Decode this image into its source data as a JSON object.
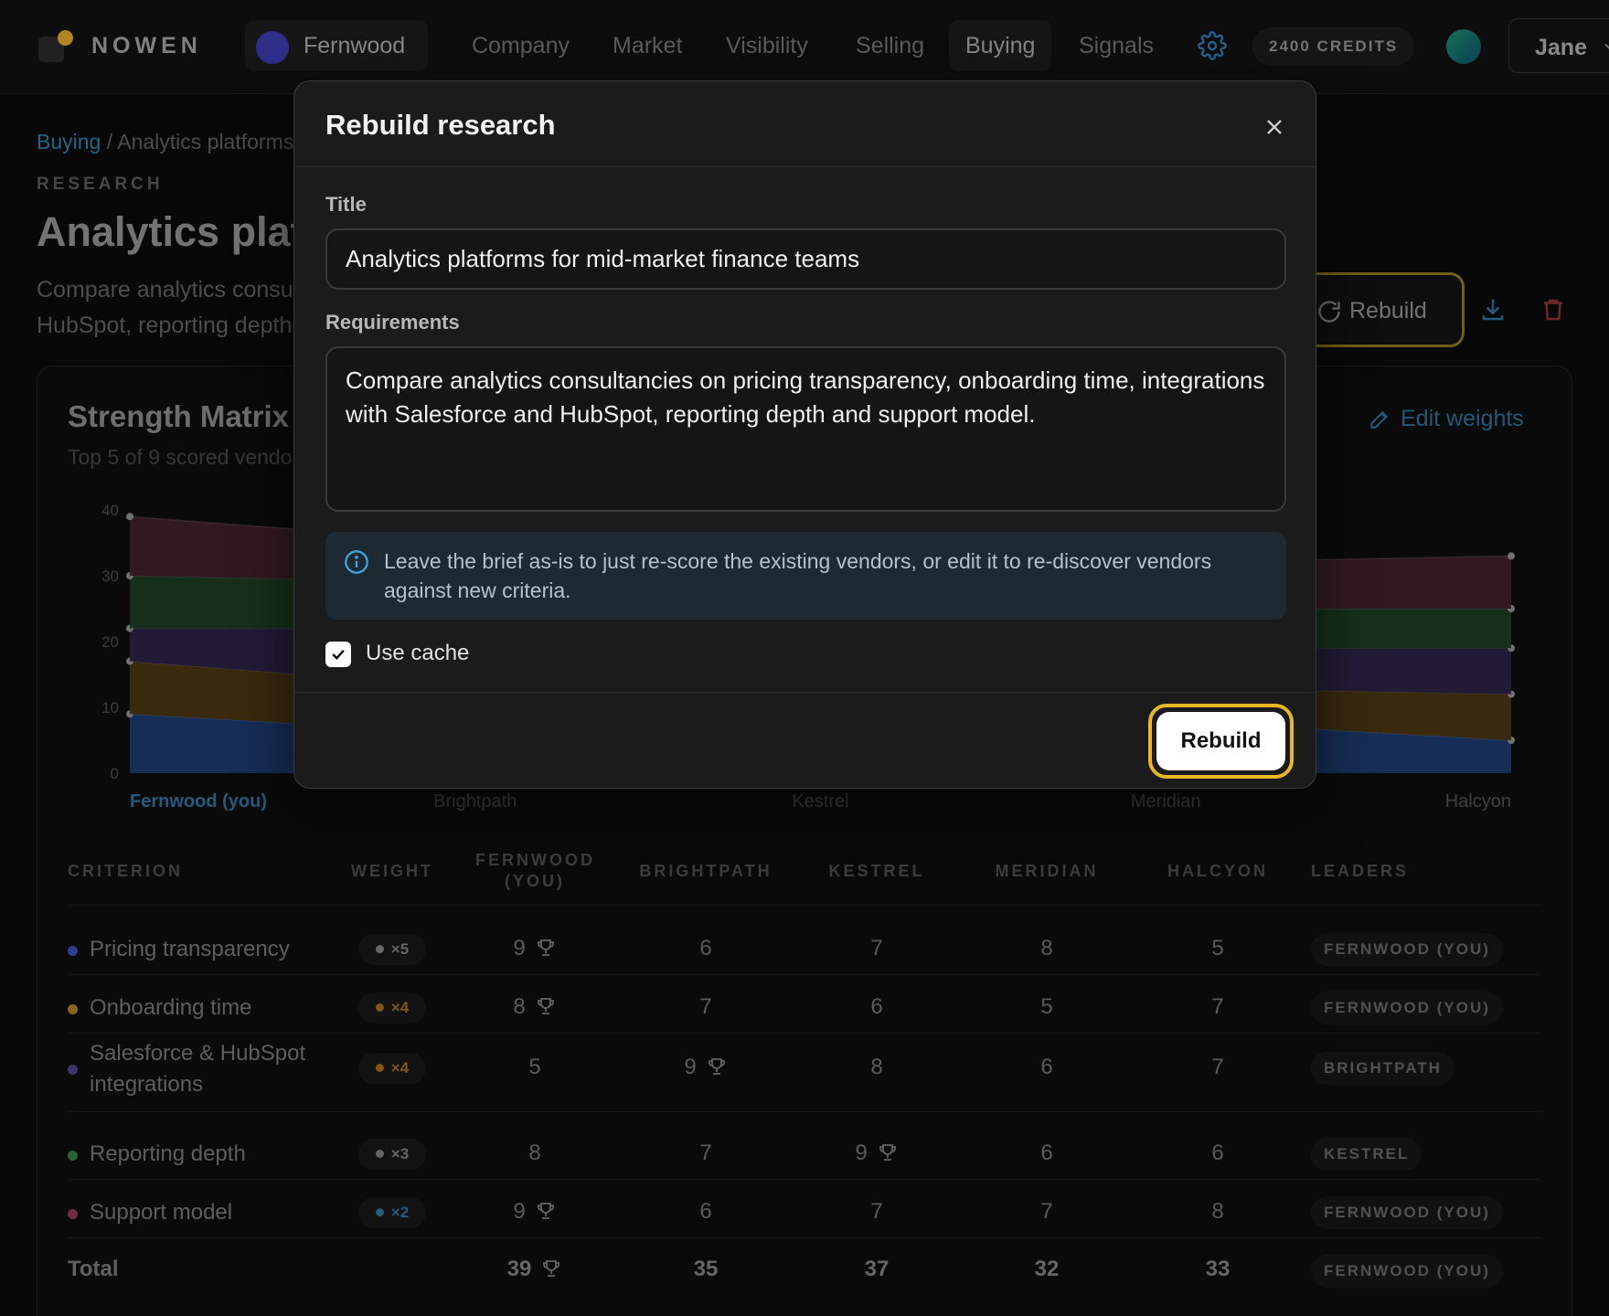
{
  "app": {
    "brand": "NOWEN",
    "workspace": "Fernwood",
    "nav": [
      "Company",
      "Market",
      "Visibility",
      "Selling",
      "Buying",
      "Signals"
    ],
    "active_nav": "Buying",
    "credits": "2400 CREDITS",
    "user": "Jane"
  },
  "page": {
    "breadcrumb_link": "Buying",
    "breadcrumb_sep": " / ",
    "breadcrumb_current": "Analytics platforms for mid-market finance teams",
    "eyebrow": "RESEARCH",
    "title": "Analytics platforms for mid-market finance teams",
    "description": "Compare analytics consultancies on pricing transparency, onboarding time, integrations with Salesforce and HubSpot, reporting depth and support model.",
    "rebuild_label": "Rebuild"
  },
  "matrix": {
    "title": "Strength Matrix",
    "subtitle": "Top 5 of 9 scored vendors",
    "edit_weights": "Edit weights",
    "table": {
      "headers": [
        "CRITERION",
        "WEIGHT",
        "FERNWOOD (YOU)",
        "BRIGHTPATH",
        "KESTREL",
        "MERIDIAN",
        "HALCYON",
        "LEADERS"
      ],
      "rows": [
        {
          "criterion": "Pricing transparency",
          "weight": "×5",
          "scores": [
            "9",
            "6",
            "7",
            "8",
            "5"
          ],
          "leader": "FERNWOOD (YOU)",
          "winner": 0,
          "dot": "#3b4fb0",
          "wcolor": "#7d7d7d"
        },
        {
          "criterion": "Onboarding time",
          "weight": "×4",
          "scores": [
            "8",
            "7",
            "6",
            "5",
            "7"
          ],
          "leader": "FERNWOOD (YOU)",
          "winner": 0,
          "dot": "#a87a20",
          "wcolor": "#a06a18"
        },
        {
          "criterion": "Salesforce & HubSpot integrations",
          "weight": "×4",
          "scores": [
            "5",
            "9",
            "8",
            "6",
            "7"
          ],
          "leader": "BRIGHTPATH",
          "winner": 1,
          "dot": "#4e3e86",
          "wcolor": "#a06a18"
        },
        {
          "criterion": "Reporting depth",
          "weight": "×3",
          "scores": [
            "8",
            "7",
            "9",
            "6",
            "6"
          ],
          "leader": "KESTREL",
          "winner": 2,
          "dot": "#2f7a3c",
          "wcolor": "#7d7d7d"
        },
        {
          "criterion": "Support model",
          "weight": "×2",
          "scores": [
            "9",
            "6",
            "7",
            "7",
            "8"
          ],
          "leader": "FERNWOOD (YOU)",
          "winner": 0,
          "dot": "#8a3550",
          "wcolor": "#2f6f96"
        }
      ],
      "total": {
        "label": "Total",
        "scores": [
          "39",
          "35",
          "37",
          "32",
          "33"
        ],
        "leader": "FERNWOOD (YOU)",
        "winner": 0
      }
    }
  },
  "chart_data": {
    "type": "area",
    "categories": [
      "Fernwood (you)",
      "Brightpath",
      "Kestrel",
      "Meridian",
      "Halcyon"
    ],
    "highlight_category": "Fernwood (you)",
    "stacked": true,
    "ylim": [
      0,
      40
    ],
    "yticks": [
      0,
      10,
      20,
      30,
      40
    ],
    "grid": false,
    "series": [
      {
        "name": "Pricing transparency",
        "values": [
          9,
          6,
          7,
          8,
          5
        ],
        "color": "#1e3a70"
      },
      {
        "name": "Onboarding time",
        "values": [
          8,
          7,
          6,
          5,
          7
        ],
        "color": "#4a3512"
      },
      {
        "name": "Salesforce & HubSpot integrations",
        "values": [
          5,
          9,
          8,
          6,
          7
        ],
        "color": "#2c2447"
      },
      {
        "name": "Reporting depth",
        "values": [
          8,
          7,
          9,
          6,
          6
        ],
        "color": "#1d3d22"
      },
      {
        "name": "Support model",
        "values": [
          9,
          6,
          7,
          7,
          8
        ],
        "color": "#40202b"
      }
    ]
  },
  "modal": {
    "title": "Rebuild research",
    "title_label": "Title",
    "title_value": "Analytics platforms for mid-market finance teams",
    "requirements_label": "Requirements",
    "requirements_value": "Compare analytics consultancies on pricing transparency, onboarding time, integrations with Salesforce and HubSpot, reporting depth and support model.",
    "info": "Leave the brief as-is to just re-score the existing vendors, or edit it to re-discover vendors against new criteria.",
    "use_cache_label": "Use cache",
    "use_cache_checked": true,
    "submit_label": "Rebuild"
  }
}
